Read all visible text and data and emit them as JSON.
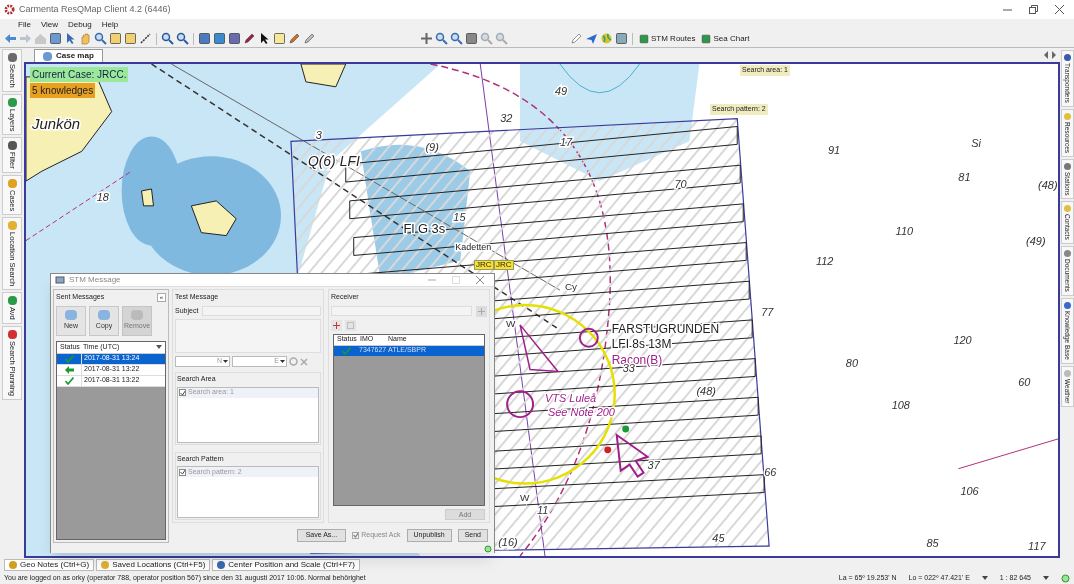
{
  "window": {
    "title": "Carmenta ResQMap Client 4.2 (6446)"
  },
  "menu": [
    "File",
    "View",
    "Debug",
    "Help"
  ],
  "toolbar_buttons": [
    {
      "label": "STM Routes"
    },
    {
      "label": "Sea Chart"
    }
  ],
  "left_tabs": [
    "Search",
    "Layers",
    "Filter",
    "Cases",
    "Location Search",
    "Avd",
    "Search Planning"
  ],
  "right_tabs": [
    "Transponders",
    "Resources",
    "Stations",
    "Contacts",
    "Documents",
    "Knowledge Base",
    "Weather"
  ],
  "map_tab": {
    "label": "Case map",
    "selected": true
  },
  "map": {
    "current_case": "Current Case: JRCC.",
    "knowledges": "5 knowledges",
    "area_tag": "Search area: 1",
    "pattern_tag": "Search pattern: 2",
    "jrc_tags": [
      "JRC",
      "JRC"
    ],
    "labels": [
      "Junkön",
      "Q(6) LFI",
      "Fl G 3s",
      "Kadetten",
      "FARSTUGRUNDEN",
      "LFI 8s 13M",
      "Racon(B)",
      "VTS Luleå",
      "See Note 200",
      "Cy",
      "W",
      "W",
      "Si"
    ],
    "soundings": [
      "49",
      "32",
      "17",
      "70",
      "91",
      "81",
      "(48)",
      "110",
      "(49)",
      "112",
      "77",
      "120",
      "80",
      "60",
      "(48)",
      "108",
      "33",
      "37",
      "66",
      "106",
      "85",
      "117",
      "45",
      "11",
      "(16)",
      "15",
      "(9)",
      "18",
      "3"
    ]
  },
  "dialog": {
    "title": "STM Message",
    "sent_messages": {
      "title": "Sent Messages",
      "collapse": "«",
      "buttons": [
        {
          "label": "New",
          "disabled": false
        },
        {
          "label": "Copy",
          "disabled": false
        },
        {
          "label": "Remove",
          "disabled": true
        }
      ],
      "columns": [
        "Status",
        "Time (UTC)"
      ],
      "rows": [
        {
          "kind": "check",
          "time": "2017-08-31 13:24",
          "selected": true
        },
        {
          "kind": "arrow",
          "time": "2017-08-31 13:22",
          "selected": false
        },
        {
          "kind": "check",
          "time": "2017-08-31 13:22",
          "selected": false
        }
      ]
    },
    "message": {
      "title": "Test Message",
      "subject_label": "Subject",
      "lat_hemisphere": "N",
      "lon_hemisphere": "E"
    },
    "search_area": {
      "title": "Search Area",
      "items": [
        {
          "label": "Search area: 1",
          "checked": true
        }
      ]
    },
    "search_pattern": {
      "title": "Search Pattern",
      "items": [
        {
          "label": "Search pattern: 2",
          "checked": true
        }
      ]
    },
    "receiver": {
      "title": "Receiver",
      "columns": [
        "Status",
        "IMO",
        "Name"
      ],
      "rows": [
        {
          "imo": "7347627",
          "name": "ATLE/SBPR",
          "selected": true
        }
      ],
      "add": {
        "label": "Add",
        "disabled": true
      }
    },
    "footer": {
      "save_as": "Save As...",
      "request_ack": {
        "label": "Request Ack",
        "checked": true,
        "disabled": true
      },
      "unpublish": "Unpublish",
      "send": "Send"
    }
  },
  "bottom_tabs": [
    "Geo Notes (Ctrl+G)",
    "Saved Locations (Ctrl+F5)",
    "Center Position and Scale (Ctrl+F7)"
  ],
  "status_bar": {
    "message": "You are logged on as orky (operator 788, operator position 567) since den 31 augusti 2017 10:06. Normal behörighet",
    "latitude": "La = 65º 19.253' N",
    "longitude": "Lo = 022º 47.421' E",
    "scale": "1 : 82 645"
  }
}
